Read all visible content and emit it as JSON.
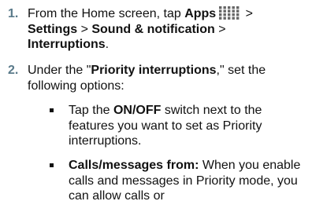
{
  "steps": [
    {
      "number": "1.",
      "intro": "From the Home screen, tap",
      "apps": "Apps",
      "sep1": " > ",
      "settings": "Settings",
      "sep2": " > ",
      "sound": "Sound & notification",
      "sep3": " > ",
      "interruptions": "Interruptions",
      "end": "."
    },
    {
      "number": "2.",
      "intro": "Under the \"",
      "priority": "Priority interruptions",
      "rest": ",\" set the following options:"
    }
  ],
  "bullets": [
    {
      "pre": "Tap the ",
      "bold": "ON/OFF",
      "rest": " switch next to the features you want to set as Priority interruptions."
    },
    {
      "bold": "Calls/messages from:",
      "rest": " When you enable calls and messages in Priority mode, you can allow calls or"
    }
  ],
  "icons": {
    "apps_grid": "apps-grid-icon"
  }
}
